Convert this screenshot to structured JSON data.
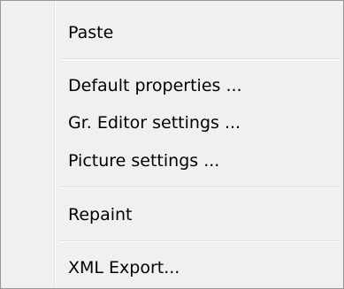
{
  "menu": {
    "items": [
      {
        "label": "Paste"
      },
      {
        "label": "Default properties ..."
      },
      {
        "label": "Gr. Editor settings ..."
      },
      {
        "label": "Picture settings ..."
      },
      {
        "label": "Repaint"
      },
      {
        "label": "XML Export..."
      }
    ]
  }
}
